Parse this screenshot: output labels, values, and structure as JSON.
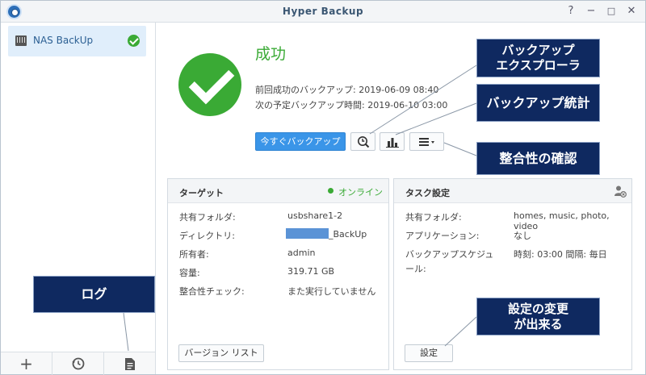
{
  "window": {
    "title": "Hyper Backup"
  },
  "titlebar_buttons": {
    "help": "?",
    "minimize": "−",
    "maximize": "□",
    "close": "✕"
  },
  "sidebar": {
    "task": {
      "name": "NAS BackUp",
      "icon": "nas-icon",
      "status_icon": "check-circle-icon"
    }
  },
  "bottom_bar": {
    "add": "+",
    "restore": "⟲",
    "log": "≡"
  },
  "status": {
    "title": "成功",
    "last_success": "前回成功のバックアップ: 2019-06-09 08:40",
    "next_scheduled": "次の予定バックアップ時間: 2019-06-10 03:00"
  },
  "actions": {
    "backup_now": "今すぐバックアップ",
    "explorer_icon": "clock-search-icon",
    "stats_icon": "bar-chart-icon",
    "menu_icon": "menu-icon"
  },
  "callouts": {
    "explorer": "バックアップ\nエクスプローラ",
    "stats": "バックアップ統計",
    "integrity": "整合性の確認",
    "log": "ログ",
    "settings": "設定の変更\nが出来る"
  },
  "target_panel": {
    "title": "ターゲット",
    "status": "オンライン",
    "rows": [
      {
        "label": "共有フォルダ:",
        "value": "usbshare1-2"
      },
      {
        "label": "ディレクトリ:",
        "value": "_BackUp"
      },
      {
        "label": "所有者:",
        "value": "admin"
      },
      {
        "label": "容量:",
        "value": "319.71 GB"
      },
      {
        "label": "整合性チェック:",
        "value": "また実行していません"
      }
    ],
    "version_list_button": "バージョン リスト"
  },
  "task_panel": {
    "title": "タスク設定",
    "rows": [
      {
        "label": "共有フォルダ:",
        "value": "homes, music, photo, video"
      },
      {
        "label": "アプリケーション:",
        "value": "なし"
      },
      {
        "label": "バックアップスケジュール:",
        "value": "時刻: 03:00 間隔: 毎日"
      }
    ],
    "settings_button": "設定"
  },
  "colors": {
    "success": "#3aaa35",
    "primary": "#3a95e8",
    "callout_bg": "#0f2960",
    "selected": "#e0eefb"
  }
}
